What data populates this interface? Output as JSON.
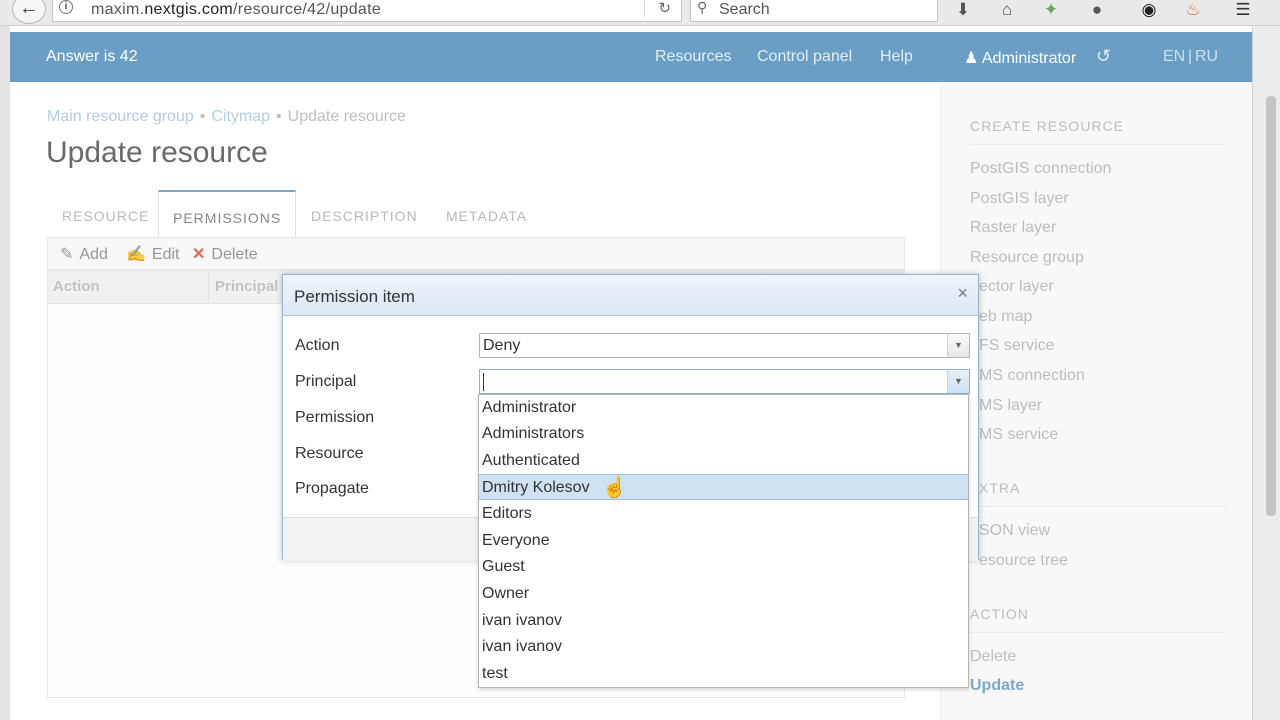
{
  "browser": {
    "url_prefix": "maxim.",
    "url_host": "nextgis.com",
    "url_path": "/resource/42/update",
    "search_placeholder": "Search"
  },
  "header": {
    "brand": "Answer is 42",
    "nav": [
      "Resources",
      "Control panel",
      "Help"
    ],
    "user": "Administrator",
    "lang_en": "EN",
    "lang_ru": "RU"
  },
  "breadcrumb": {
    "items": [
      "Main resource group",
      "Citymap"
    ],
    "current": "Update resource"
  },
  "page_title": "Update resource",
  "tabs": [
    "RESOURCE",
    "PERMISSIONS",
    "DESCRIPTION",
    "METADATA"
  ],
  "toolbar": {
    "add": "Add",
    "edit": "Edit",
    "delete": "Delete"
  },
  "grid": {
    "columns": [
      "Action",
      "Principal"
    ]
  },
  "sidebar": {
    "create_heading": "CREATE RESOURCE",
    "create_items": [
      "PostGIS connection",
      "PostGIS layer",
      "Raster layer",
      "Resource group",
      "ector layer",
      "eb map",
      "FS service",
      "MS connection",
      "MS layer",
      "MS service"
    ],
    "extra_heading": "XTRA",
    "extra_items": [
      "SON view",
      "esource tree"
    ],
    "action_heading": "ACTION",
    "action_items": [
      "Delete",
      "Update"
    ]
  },
  "dialog": {
    "title": "Permission item",
    "labels": [
      "Action",
      "Principal",
      "Permission",
      "Resource",
      "Propagate"
    ],
    "action_value": "Deny",
    "principal_value": ""
  },
  "dropdown": {
    "options": [
      "Administrator",
      "Administrators",
      "Authenticated",
      "Dmitry Kolesov",
      "Editors",
      "Everyone",
      "Guest",
      "Owner",
      "ivan ivanov",
      "ivan ivanov",
      "test"
    ],
    "hovered_index": 3
  },
  "colors": {
    "header": "#6a9ec4",
    "accent": "#6a9ec4",
    "delete": "#e0523f"
  }
}
